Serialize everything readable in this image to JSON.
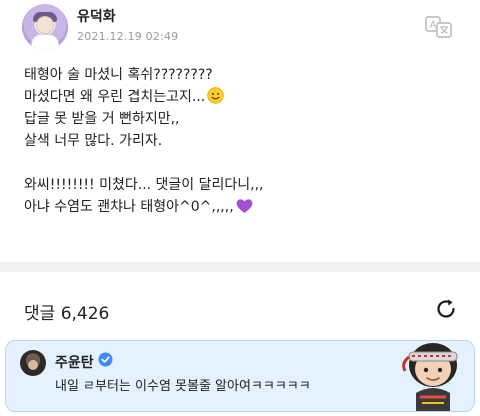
{
  "post": {
    "author": "유덕화",
    "date": "2021.12.19 02:49",
    "lines": [
      "태형아 술 마셨니 혹쉬????????",
      "마셨다면 왜 우린 겹치는고지...",
      "답글 못 받을 거 뻔하지만,,",
      "살색 너무 많다. 가리자.",
      "",
      "와씨!!!!!!!! 미쳤다... 댓글이 달리다니,,,",
      "아냐 수염도 괜챠나 태형아^0^,,,,,"
    ],
    "emojis": [
      "slightly-smiling-face",
      "purple-heart"
    ]
  },
  "comments": {
    "label": "댓글",
    "count": "6,426"
  },
  "comment": {
    "author": "주윤탄",
    "text": "내일 ㄹ부터는 이수염 못볼줄 알아여ㅋㅋㅋㅋㅋ",
    "verified": true
  },
  "colors": {
    "card_bg": "#e4f1ff",
    "card_border": "#b9d5f5",
    "verified_blue": "#3d8bfd",
    "heart_purple": "#a64dd6"
  }
}
